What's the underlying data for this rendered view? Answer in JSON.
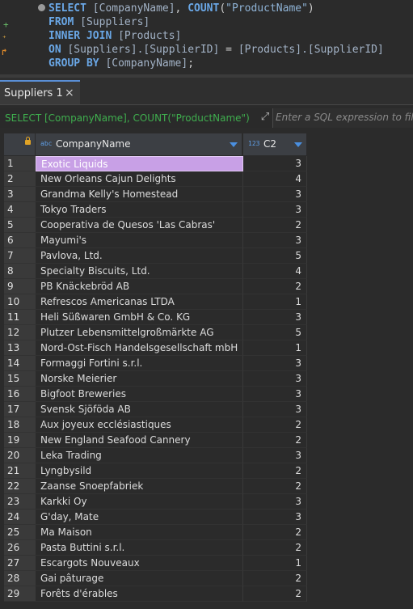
{
  "editor": {
    "lines": [
      [
        {
          "t": "SELECT ",
          "c": "kw"
        },
        {
          "t": "[CompanyName]",
          "c": "id"
        },
        {
          "t": ", ",
          "c": "op"
        },
        {
          "t": "COUNT",
          "c": "kw"
        },
        {
          "t": "(",
          "c": "op"
        },
        {
          "t": "\"ProductName\"",
          "c": "str"
        },
        {
          "t": ")",
          "c": "op"
        }
      ],
      [
        {
          "t": "FROM ",
          "c": "kw"
        },
        {
          "t": "[Suppliers]",
          "c": "id"
        }
      ],
      [
        {
          "t": "INNER JOIN ",
          "c": "kw"
        },
        {
          "t": "[Products]",
          "c": "id"
        }
      ],
      [
        {
          "t": "ON ",
          "c": "kw"
        },
        {
          "t": "[Suppliers].[SupplierID]",
          "c": "id"
        },
        {
          "t": " = ",
          "c": "op"
        },
        {
          "t": "[Products].[SupplierID]",
          "c": "id"
        }
      ],
      [
        {
          "t": "GROUP BY ",
          "c": "kw"
        },
        {
          "t": "[CompanyName]",
          "c": "id"
        },
        {
          "t": ";",
          "c": "op"
        }
      ]
    ]
  },
  "tab": {
    "label": "Suppliers 1",
    "close": "×"
  },
  "filter": {
    "query": "SELECT [CompanyName], COUNT(\"ProductName\")",
    "placeholder": "Enter a SQL expression to filter"
  },
  "grid": {
    "columns": [
      {
        "type_icon": "abc",
        "label": "CompanyName"
      },
      {
        "type_icon": "123",
        "label": "C2"
      }
    ],
    "selected_row": 1,
    "rows": [
      [
        "1",
        "Exotic Liquids",
        "3"
      ],
      [
        "2",
        "New Orleans Cajun Delights",
        "4"
      ],
      [
        "3",
        "Grandma Kelly's Homestead",
        "3"
      ],
      [
        "4",
        "Tokyo Traders",
        "3"
      ],
      [
        "5",
        "Cooperativa de Quesos 'Las Cabras'",
        "2"
      ],
      [
        "6",
        "Mayumi's",
        "3"
      ],
      [
        "7",
        "Pavlova, Ltd.",
        "5"
      ],
      [
        "8",
        "Specialty Biscuits, Ltd.",
        "4"
      ],
      [
        "9",
        "PB Knäckebröd AB",
        "2"
      ],
      [
        "10",
        "Refrescos Americanas LTDA",
        "1"
      ],
      [
        "11",
        "Heli Süßwaren GmbH & Co. KG",
        "3"
      ],
      [
        "12",
        "Plutzer Lebensmittelgroßmärkte AG",
        "5"
      ],
      [
        "13",
        "Nord-Ost-Fisch Handelsgesellschaft mbH",
        "1"
      ],
      [
        "14",
        "Formaggi Fortini s.r.l.",
        "3"
      ],
      [
        "15",
        "Norske Meierier",
        "3"
      ],
      [
        "16",
        "Bigfoot Breweries",
        "3"
      ],
      [
        "17",
        "Svensk Sjöföda AB",
        "3"
      ],
      [
        "18",
        "Aux joyeux ecclésiastiques",
        "2"
      ],
      [
        "19",
        "New England Seafood Cannery",
        "2"
      ],
      [
        "20",
        "Leka Trading",
        "3"
      ],
      [
        "21",
        "Lyngbysild",
        "2"
      ],
      [
        "22",
        "Zaanse Snoepfabriek",
        "2"
      ],
      [
        "23",
        "Karkki Oy",
        "3"
      ],
      [
        "24",
        "G'day, Mate",
        "3"
      ],
      [
        "25",
        "Ma Maison",
        "2"
      ],
      [
        "26",
        "Pasta Buttini s.r.l.",
        "2"
      ],
      [
        "27",
        "Escargots Nouveaux",
        "1"
      ],
      [
        "28",
        "Gai pâturage",
        "2"
      ],
      [
        "29",
        "Forêts d'érables",
        "2"
      ]
    ]
  }
}
